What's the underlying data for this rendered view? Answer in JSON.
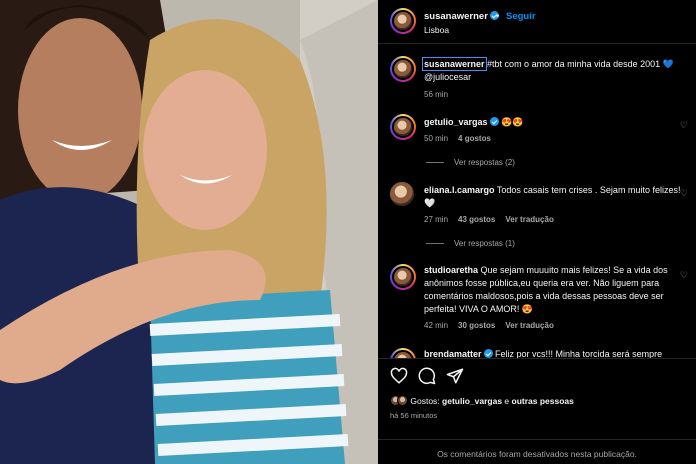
{
  "header": {
    "username": "susanawerner",
    "follow_label": "Seguir",
    "separator": "•",
    "location": "Lisboa"
  },
  "caption": {
    "username": "susanawerner",
    "text": "#tbt com o amor da minha vida desde 2001 💙 @juliocesar",
    "time": "56 min"
  },
  "comments": [
    {
      "username": "getulio_vargas",
      "text": "😍😍",
      "time": "50 min",
      "likes": "4 gostos",
      "reply": "",
      "view_replies": "Ver respostas (2)"
    },
    {
      "username": "eliana.l.camargo",
      "text": "Todos casais tem crises . Sejam muito felizes! 🤍",
      "time": "27 min",
      "likes": "43 gostos",
      "reply": "Ver tradução",
      "view_replies": "Ver respostas (1)"
    },
    {
      "username": "studioaretha",
      "text": "Que sejam muuuito mais felizes! Se a vida dos anônimos fosse pública,eu queria era ver. Não liguem para comentários maldosos,pois a vida dessas pessoas deve ser perfeita! VIVA O AMOR! 😍",
      "time": "42 min",
      "likes": "30 gostos",
      "reply": "Ver tradução"
    },
    {
      "username": "brendamatter",
      "text": "Feliz por vcs!!! Minha torcida será sempre"
    }
  ],
  "actions": {
    "icons": [
      "heart-icon",
      "comment-icon",
      "share-icon"
    ]
  },
  "likes": {
    "prefix": "Gostos:",
    "user": "getulio_vargas",
    "joiner": "e",
    "others": "outras pessoas"
  },
  "posted_ago": "há 56 minutos",
  "comments_disabled": "Os comentários foram desativados nesta publicação.",
  "colors": {
    "link": "#0095f6",
    "verified": "#1d9bf0",
    "background": "#000000"
  }
}
